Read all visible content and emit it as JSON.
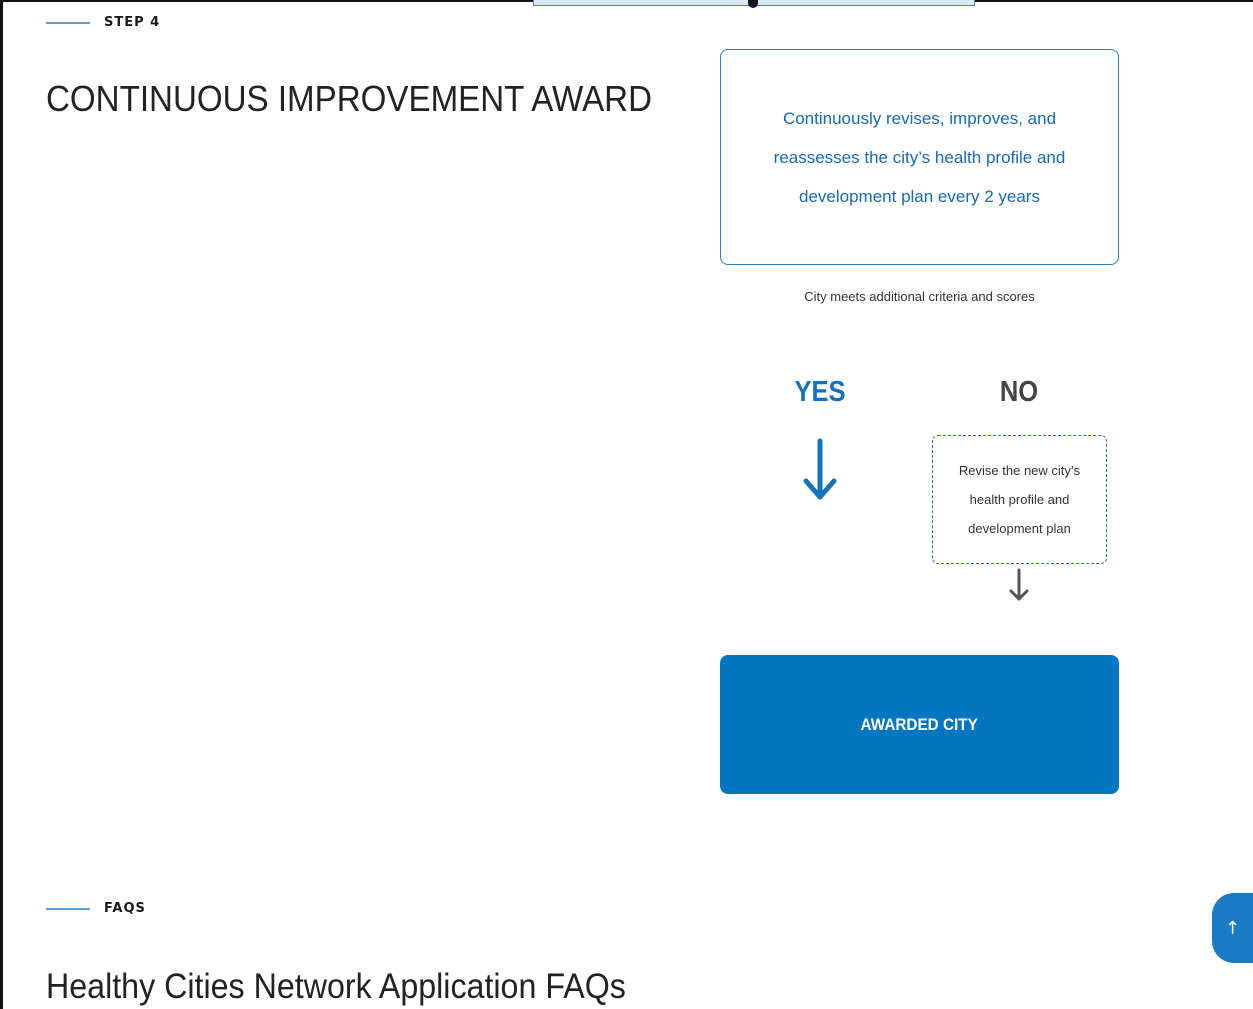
{
  "step": {
    "eyebrow": "STEP 4",
    "title": "CONTINUOUS IMPROVEMENT AWARD"
  },
  "flow": {
    "criteria_text": "Continuously revises, improves, and reassesses the city’s health profile and development plan every 2 years",
    "condition_text": "City meets additional criteria and scores",
    "yes_label": "YES",
    "no_label": "NO",
    "revise_text": "Revise the new city’s health profile and development plan",
    "outcome_label": "AWARDED CITY",
    "icons": {
      "yes_arrow": "arrow-down-icon",
      "no_arrow": "arrow-down-icon"
    }
  },
  "faq": {
    "eyebrow": "FAQS",
    "title": "Healthy Cities Network Application FAQs"
  },
  "scroll_top": {
    "glyph": "↑",
    "icon": "arrow-up-icon"
  },
  "colors": {
    "accent": "#0276c1",
    "accent_text": "#1769b3",
    "no_text": "#444444"
  }
}
